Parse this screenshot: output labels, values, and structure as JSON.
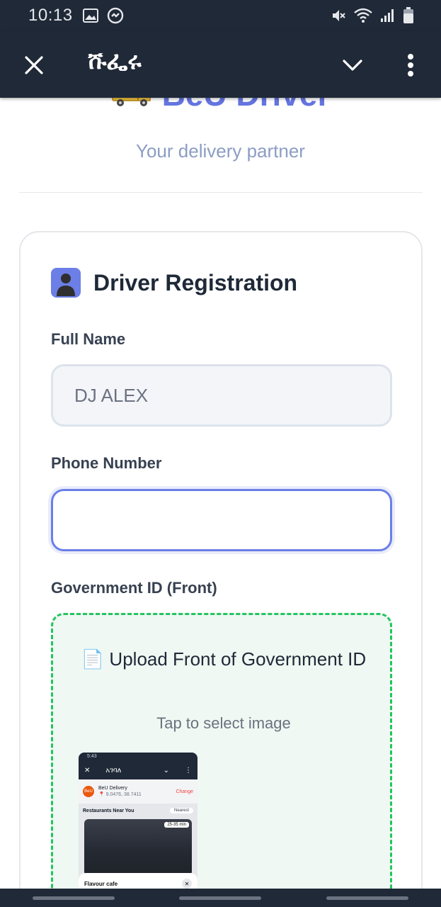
{
  "status_bar": {
    "time": "10:13",
    "left_icons": [
      "image-icon",
      "messenger-icon"
    ],
    "right_icons": [
      "mute-icon",
      "wifi-icon",
      "signal-icon",
      "battery-icon"
    ]
  },
  "app_bar": {
    "title": "ሹፌሩ",
    "actions": [
      "close-icon",
      "chevron-down-icon",
      "more-vert-icon"
    ]
  },
  "brand": {
    "name": "BeU Driver",
    "tagline": "Your delivery partner",
    "accent_color": "#6474e0"
  },
  "form": {
    "title": "Driver Registration",
    "full_name": {
      "label": "Full Name",
      "value": "DJ ALEX"
    },
    "phone": {
      "label": "Phone Number",
      "value": ""
    },
    "gov_id_front": {
      "label": "Government ID (Front)",
      "upload_title": "📄 Upload Front of Government ID",
      "upload_hint": "Tap to select image"
    }
  },
  "thumbnail": {
    "time": "5:43",
    "title": "አገባለ",
    "app_name": "BeU Delivery",
    "logo_text": "BeU",
    "coords": "📍 9.0476, 38.7411",
    "change": "Change",
    "section": "Restaurants Near You",
    "sort": "Nearest",
    "eta": "25-35 min",
    "restaurant": "Flavour cafe",
    "close": "✕"
  },
  "colors": {
    "app_bar": "#1f2937",
    "primary": "#6b7fe6",
    "upload_border": "#22c55e"
  }
}
